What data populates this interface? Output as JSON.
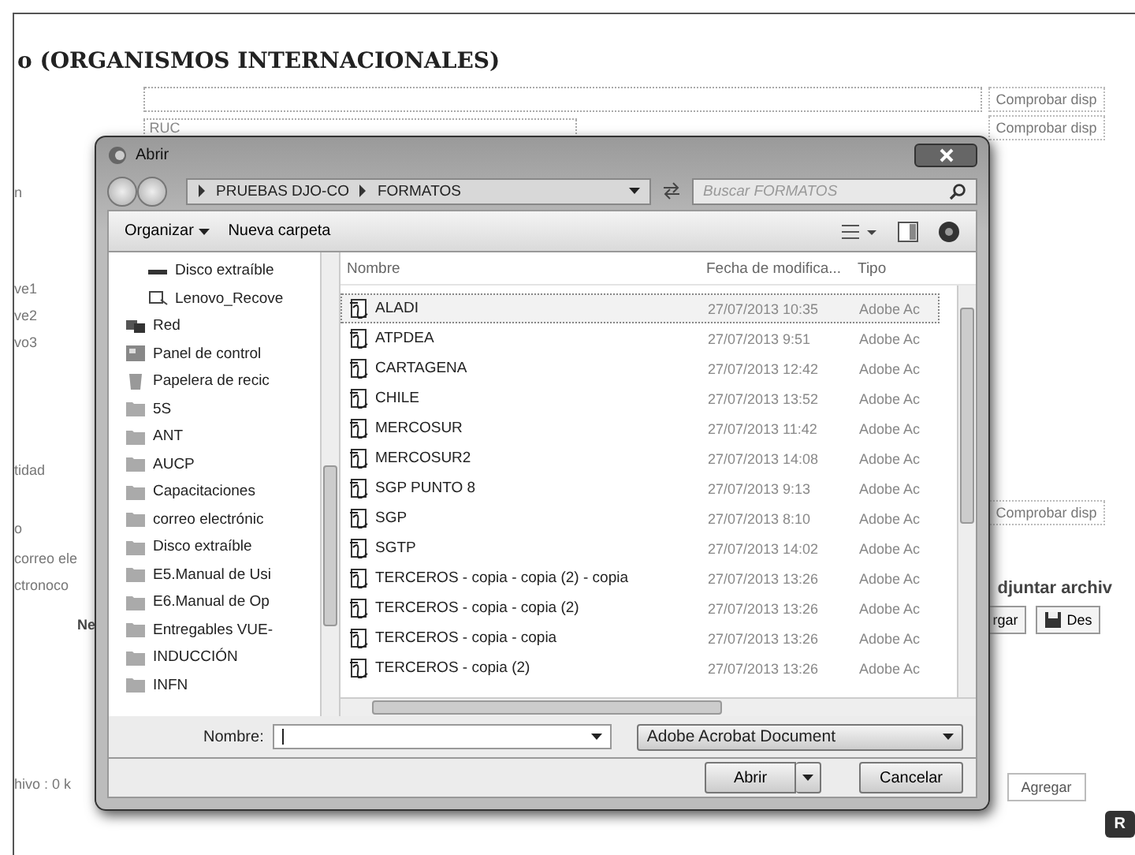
{
  "page": {
    "title": "o (ORGANISMOS INTERNACIONALES)",
    "select_value": "RUC",
    "left_labels": [
      "n",
      "ve1",
      "ve2",
      "vo3",
      "tidad",
      "o",
      "correo ele",
      "ctronoco",
      "Ne",
      "hivo : 0 k"
    ],
    "check_buttons": [
      "Comprobar disp",
      "Comprobar disp",
      "Comprobar disp"
    ],
    "attach_heading": "djuntar archiv",
    "upload_button": "rgar",
    "download_button": "Des",
    "add_button": "Agregar",
    "submit_button": "R"
  },
  "dialog": {
    "title": "Abrir",
    "breadcrumb": [
      "PRUEBAS DJO-CO",
      "FORMATOS"
    ],
    "search": {
      "placeholder": "Buscar FORMATOS"
    },
    "toolbar": [
      "Organizar",
      "Nueva carpeta"
    ],
    "nav": [
      {
        "label": "Disco extraíble",
        "kind": "drive"
      },
      {
        "label": "Lenovo_Recove",
        "kind": "recovery"
      },
      {
        "label": "Red",
        "kind": "network"
      },
      {
        "label": "Panel de control",
        "kind": "control"
      },
      {
        "label": "Papelera de recic",
        "kind": "recycle"
      },
      {
        "label": "5S",
        "kind": "folder"
      },
      {
        "label": "ANT",
        "kind": "folder"
      },
      {
        "label": "AUCP",
        "kind": "folder"
      },
      {
        "label": "Capacitaciones",
        "kind": "folder"
      },
      {
        "label": "correo electrónic",
        "kind": "folder"
      },
      {
        "label": "Disco extraíble",
        "kind": "folder"
      },
      {
        "label": "E5.Manual de Usi",
        "kind": "folder"
      },
      {
        "label": "E6.Manual de Op",
        "kind": "folder"
      },
      {
        "label": "Entregables VUE-",
        "kind": "folder"
      },
      {
        "label": "INDUCCIÓN",
        "kind": "folder"
      },
      {
        "label": "INFN",
        "kind": "folder"
      }
    ],
    "columns": [
      "Nombre",
      "Fecha de modifica...",
      "Tipo"
    ],
    "files": [
      {
        "name": "ALADI",
        "date": "27/07/2013 10:35",
        "type": "Adobe Ac",
        "selected": true
      },
      {
        "name": "ATPDEA",
        "date": "27/07/2013 9:51",
        "type": "Adobe Ac",
        "selected": false
      },
      {
        "name": "CARTAGENA",
        "date": "27/07/2013 12:42",
        "type": "Adobe Ac",
        "selected": false
      },
      {
        "name": "CHILE",
        "date": "27/07/2013 13:52",
        "type": "Adobe Ac",
        "selected": false
      },
      {
        "name": "MERCOSUR",
        "date": "27/07/2013 11:42",
        "type": "Adobe Ac",
        "selected": false
      },
      {
        "name": "MERCOSUR2",
        "date": "27/07/2013 14:08",
        "type": "Adobe Ac",
        "selected": false
      },
      {
        "name": "SGP PUNTO 8",
        "date": "27/07/2013 9:13",
        "type": "Adobe Ac",
        "selected": false
      },
      {
        "name": "SGP",
        "date": "27/07/2013 8:10",
        "type": "Adobe Ac",
        "selected": false
      },
      {
        "name": "SGTP",
        "date": "27/07/2013 14:02",
        "type": "Adobe Ac",
        "selected": false
      },
      {
        "name": "TERCEROS - copia - copia (2) - copia",
        "date": "27/07/2013 13:26",
        "type": "Adobe Ac",
        "selected": false
      },
      {
        "name": "TERCEROS - copia - copia (2)",
        "date": "27/07/2013 13:26",
        "type": "Adobe Ac",
        "selected": false
      },
      {
        "name": "TERCEROS - copia - copia",
        "date": "27/07/2013 13:26",
        "type": "Adobe Ac",
        "selected": false
      },
      {
        "name": "TERCEROS - copia (2)",
        "date": "27/07/2013 13:26",
        "type": "Adobe Ac",
        "selected": false
      }
    ],
    "filename_label": "Nombre:",
    "filetype": "Adobe Acrobat Document",
    "open_button": "Abrir",
    "cancel_button": "Cancelar"
  }
}
